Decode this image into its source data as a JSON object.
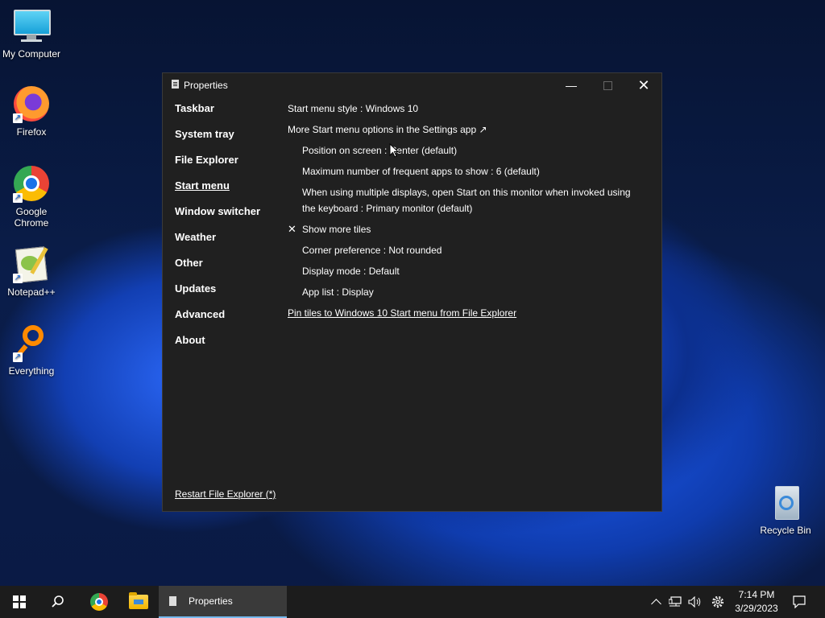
{
  "desktop": {
    "icons": [
      {
        "label": "My Computer",
        "icon": "computer-icon"
      },
      {
        "label": "Firefox",
        "icon": "firefox-icon"
      },
      {
        "label": "Google Chrome",
        "icon": "chrome-icon"
      },
      {
        "label": "Notepad++",
        "icon": "notepadpp-icon"
      },
      {
        "label": "Everything",
        "icon": "everything-icon"
      },
      {
        "label": "Recycle Bin",
        "icon": "recycle-bin-icon"
      }
    ]
  },
  "window": {
    "title": "Properties",
    "nav": [
      "Taskbar",
      "System tray",
      "File Explorer",
      "Start menu",
      "Window switcher",
      "Weather",
      "Other",
      "Updates",
      "Advanced",
      "About"
    ],
    "active_nav": "Start menu",
    "content": {
      "start_menu_style": "Start menu style : Windows 10",
      "more_options": "More Start menu options in the Settings app ↗",
      "position": "Position on screen : Center (default)",
      "max_frequent": "Maximum number of frequent apps to show : 6 (default)",
      "multi_display_1": "When using multiple displays, open Start on this monitor when invoked using",
      "multi_display_2": "the keyboard : Primary monitor (default)",
      "show_more_tiles": "Show more tiles",
      "show_more_tiles_checked": true,
      "check_glyph": "✕",
      "corner": "Corner preference : Not rounded",
      "display_mode": "Display mode : Default",
      "app_list": "App list : Display",
      "pin_tiles": "Pin tiles to Windows 10 Start menu from File Explorer"
    },
    "restart": "Restart File Explorer (*)"
  },
  "taskbar": {
    "active_app": "Properties",
    "time": "7:14 PM",
    "date": "3/29/2023",
    "accent": "#76b9ed"
  }
}
